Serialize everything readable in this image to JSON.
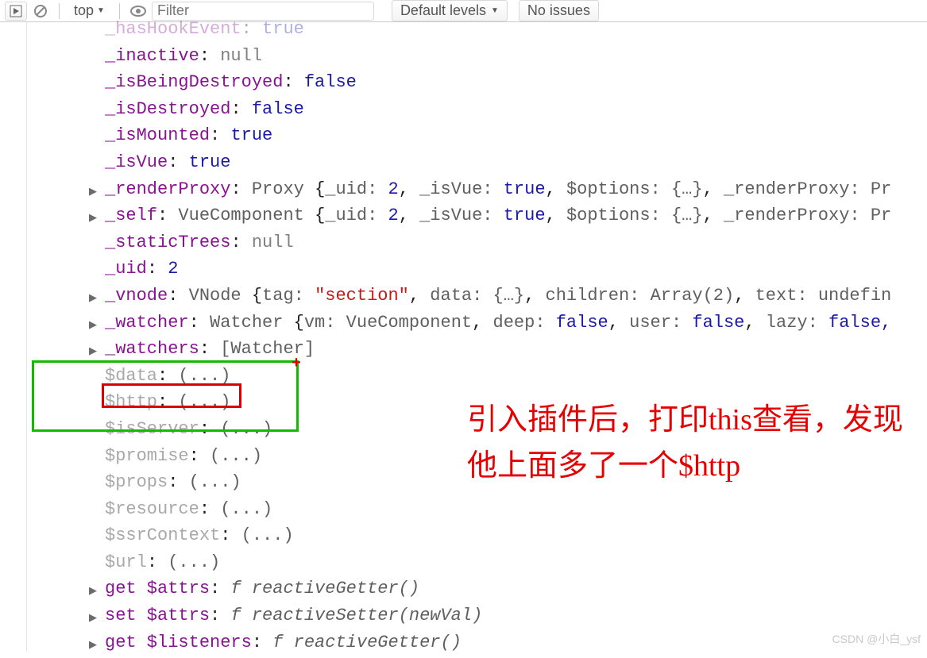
{
  "toolbar": {
    "context_label": "top",
    "filter_placeholder": "Filter",
    "levels_label": "Default levels",
    "issues_label": "No issues"
  },
  "rows": [
    {
      "key": "_hasHookEvent",
      "val": "true",
      "cls": "bool",
      "exp": false,
      "faded": true
    },
    {
      "key": "_inactive",
      "val": "null",
      "cls": "null",
      "exp": false
    },
    {
      "key": "_isBeingDestroyed",
      "val": "false",
      "cls": "bool",
      "exp": false
    },
    {
      "key": "_isDestroyed",
      "val": "false",
      "cls": "bool",
      "exp": false
    },
    {
      "key": "_isMounted",
      "val": "true",
      "cls": "bool",
      "exp": false
    },
    {
      "key": "_isVue",
      "val": "true",
      "cls": "bool",
      "exp": false
    },
    {
      "key": "_renderProxy",
      "type": "Proxy",
      "preview": [
        {
          "k": "_uid",
          "v": "2",
          "c": "num"
        },
        {
          "k": "_isVue",
          "v": "true",
          "c": "bool"
        },
        {
          "k": "$options",
          "v": "{…}",
          "c": "greyval"
        },
        {
          "k": "_renderProxy",
          "v": "Pr",
          "c": "greyval"
        }
      ],
      "exp": true
    },
    {
      "key": "_self",
      "type": "VueComponent",
      "preview": [
        {
          "k": "_uid",
          "v": "2",
          "c": "num"
        },
        {
          "k": "_isVue",
          "v": "true",
          "c": "bool"
        },
        {
          "k": "$options",
          "v": "{…}",
          "c": "greyval"
        },
        {
          "k": "_renderProxy",
          "v": "Pr",
          "c": "greyval"
        }
      ],
      "exp": true
    },
    {
      "key": "_staticTrees",
      "val": "null",
      "cls": "null",
      "exp": false
    },
    {
      "key": "_uid",
      "val": "2",
      "cls": "num",
      "exp": false
    },
    {
      "key": "_vnode",
      "type": "VNode",
      "preview": [
        {
          "k": "tag",
          "v": "\"section\"",
          "c": "str"
        },
        {
          "k": "data",
          "v": "{…}",
          "c": "greyval"
        },
        {
          "k": "children",
          "v": "Array(2)",
          "c": "greyval"
        },
        {
          "k": "text",
          "v": "undefin",
          "c": "greyval"
        }
      ],
      "exp": true
    },
    {
      "key": "_watcher",
      "type": "Watcher",
      "preview": [
        {
          "k": "vm",
          "v": "VueComponent",
          "c": "greyval"
        },
        {
          "k": "deep",
          "v": "false",
          "c": "bool"
        },
        {
          "k": "user",
          "v": "false",
          "c": "bool"
        },
        {
          "k": "lazy",
          "v": "false,",
          "c": "bool"
        }
      ],
      "exp": true
    },
    {
      "key": "_watchers",
      "raw": "[Watcher]",
      "exp": true
    },
    {
      "key": "$data",
      "getter": true
    },
    {
      "key": "$http",
      "getter": true
    },
    {
      "key": "$isServer",
      "getter": true
    },
    {
      "key": "$promise",
      "getter": true
    },
    {
      "key": "$props",
      "getter": true
    },
    {
      "key": "$resource",
      "getter": true
    },
    {
      "key": "$ssrContext",
      "getter": true
    },
    {
      "key": "$url",
      "getter": true
    },
    {
      "key": "get $attrs",
      "fn": "reactiveGetter()",
      "exp": true
    },
    {
      "key": "set $attrs",
      "fn": "reactiveSetter(newVal)",
      "exp": true
    },
    {
      "key": "get $listeners",
      "fn": "reactiveGetter()",
      "exp": true
    }
  ],
  "annotation": {
    "text": "引入插件后，打印this查看，发现他上面多了一个$http",
    "plus": "+"
  },
  "watermark": "CSDN @小白_ysf"
}
